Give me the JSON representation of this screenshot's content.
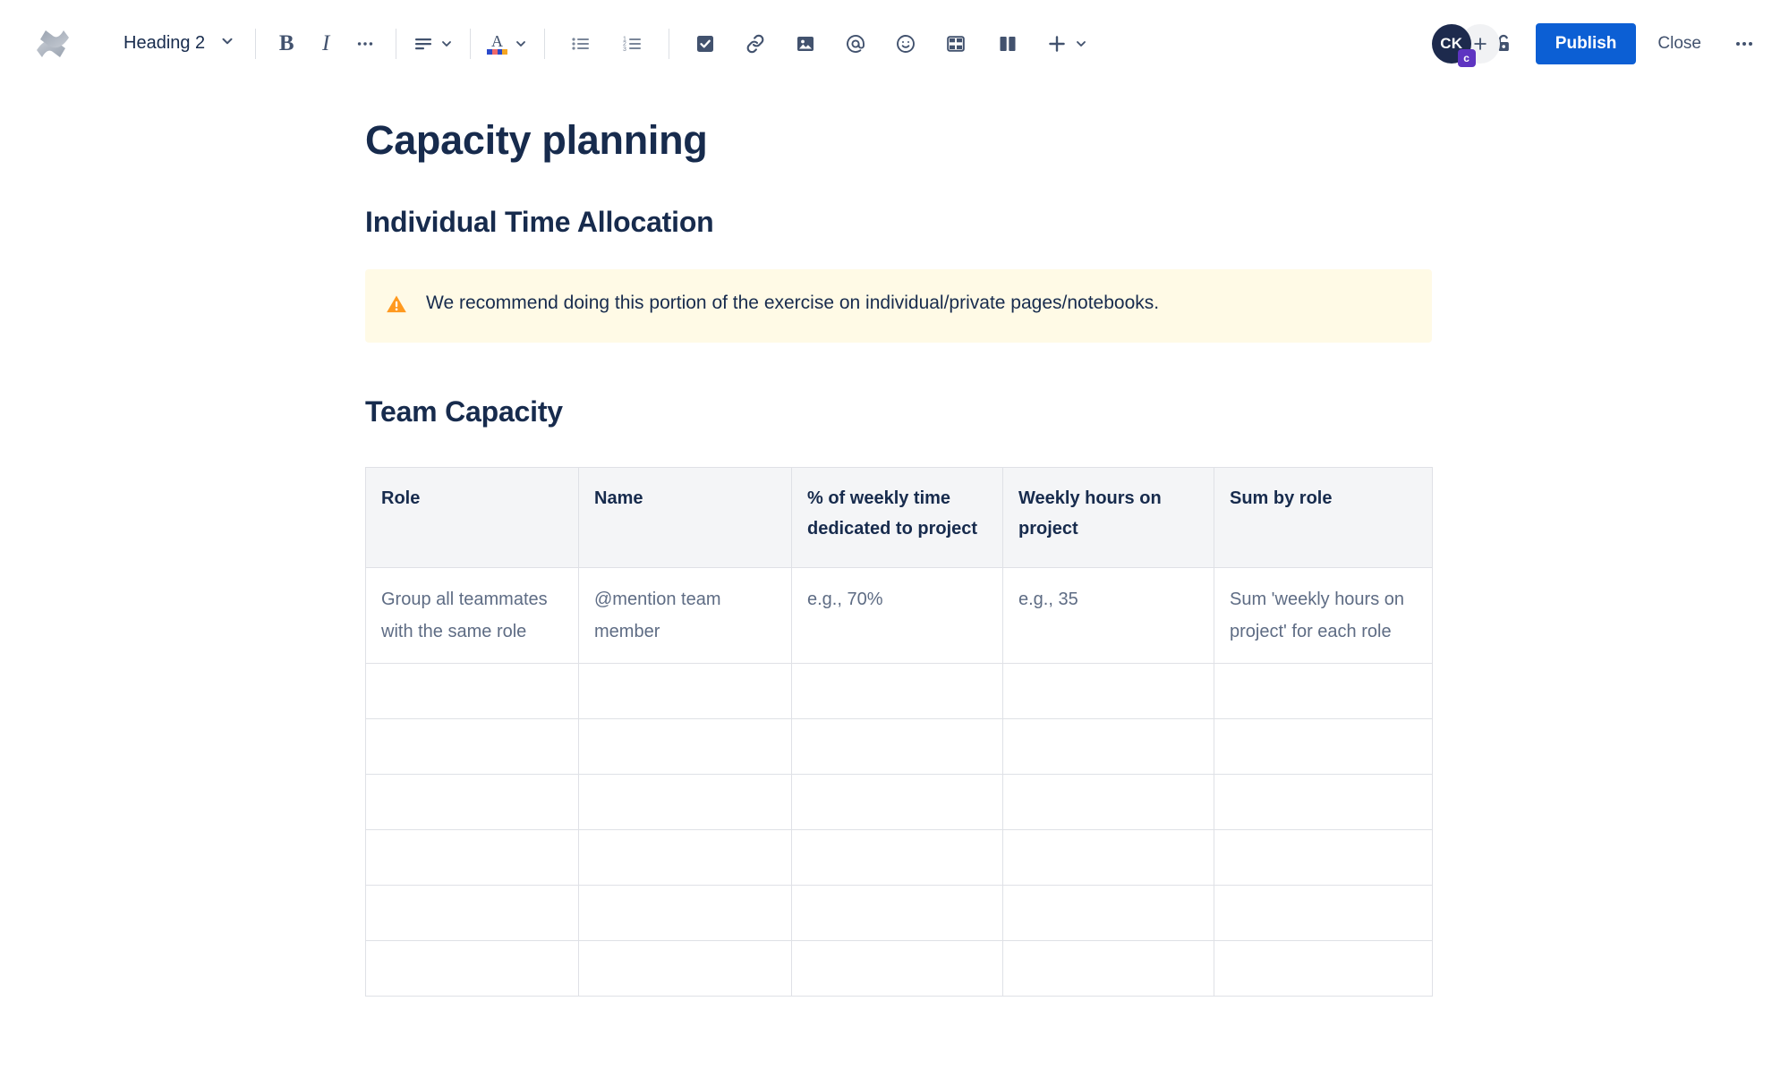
{
  "toolbar": {
    "logo_icon": "confluence-logo-icon",
    "style_select": {
      "label": "Heading 2",
      "chevron_icon": "chevron-down-icon"
    },
    "buttons": [
      {
        "name": "bold-button",
        "label": "B",
        "icon": "bold-icon"
      },
      {
        "name": "italic-button",
        "label": "I",
        "icon": "italic-icon"
      },
      {
        "name": "more-formatting-button",
        "label": "•••",
        "icon": "ellipsis-icon"
      },
      {
        "name": "text-align-button",
        "icon": "text-align-left-icon"
      },
      {
        "name": "text-color-button",
        "icon": "text-color-icon"
      },
      {
        "name": "bullet-list-button",
        "icon": "bullet-list-icon"
      },
      {
        "name": "numbered-list-button",
        "icon": "numbered-list-icon"
      },
      {
        "name": "action-item-button",
        "icon": "checkbox-checked-icon"
      },
      {
        "name": "link-button",
        "icon": "link-icon"
      },
      {
        "name": "image-button",
        "icon": "image-icon"
      },
      {
        "name": "mention-button",
        "icon": "at-mention-icon"
      },
      {
        "name": "emoji-button",
        "icon": "emoji-smiley-icon"
      },
      {
        "name": "table-button",
        "icon": "table-grid-icon"
      },
      {
        "name": "layout-button",
        "icon": "two-column-layout-icon"
      },
      {
        "name": "insert-button",
        "icon": "plus-icon"
      }
    ],
    "avatar": {
      "initials": "CK",
      "badge": "c",
      "badge_color": "#5e34c1",
      "bg_color": "#1d2a4d"
    },
    "add_people_label": "+",
    "restrictions_icon": "unlock-icon",
    "publish_label": "Publish",
    "close_label": "Close",
    "more_options_label": "•••",
    "accent_color": "#0c5fd4"
  },
  "page": {
    "title": "Capacity planning",
    "section_one_heading": "Individual Time Allocation",
    "warning": {
      "icon": "warning-triangle-icon",
      "icon_color": "#ff991f",
      "background": "#fffae6",
      "text": "We recommend doing this portion of the exercise on individual/private pages/notebooks."
    },
    "section_two_heading": "Team Capacity",
    "table": {
      "headers": [
        "Role",
        "Name",
        "% of weekly time dedicated to project",
        "Weekly hours on project",
        "Sum by role"
      ],
      "rows": [
        [
          "Group all teammates with the same role",
          "@mention team member",
          "e.g., 70%",
          "e.g., 35",
          "Sum 'weekly hours on project' for each role"
        ],
        [
          "",
          "",
          "",
          "",
          ""
        ],
        [
          "",
          "",
          "",
          "",
          ""
        ],
        [
          "",
          "",
          "",
          "",
          ""
        ],
        [
          "",
          "",
          "",
          "",
          ""
        ],
        [
          "",
          "",
          "",
          "",
          ""
        ],
        [
          "",
          "",
          "",
          "",
          ""
        ]
      ]
    }
  }
}
